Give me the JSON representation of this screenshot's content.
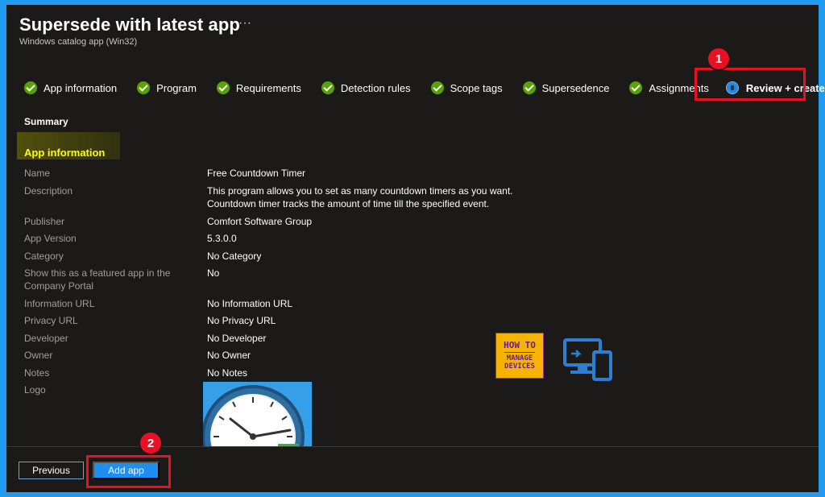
{
  "header": {
    "title": "Supersede with latest app",
    "more_label": "···",
    "subtitle": "Windows catalog app (Win32)"
  },
  "steps": [
    {
      "label": "App information",
      "state": "complete"
    },
    {
      "label": "Program",
      "state": "complete"
    },
    {
      "label": "Requirements",
      "state": "complete"
    },
    {
      "label": "Detection rules",
      "state": "complete"
    },
    {
      "label": "Scope tags",
      "state": "complete"
    },
    {
      "label": "Supersedence",
      "state": "complete"
    },
    {
      "label": "Assignments",
      "state": "complete"
    },
    {
      "label": "Review + create",
      "state": "active"
    }
  ],
  "callouts": {
    "one": "1",
    "two": "2"
  },
  "summary": {
    "heading": "Summary",
    "section_title": "App information",
    "rows": [
      {
        "key": "Name",
        "value": "Free Countdown Timer"
      },
      {
        "key": "Description",
        "value": "This program allows you to set as many countdown timers as you want.",
        "value2": "Countdown timer tracks the amount of time till the specified event."
      },
      {
        "key": "Publisher",
        "value": "Comfort Software Group"
      },
      {
        "key": "App Version",
        "value": "5.3.0.0"
      },
      {
        "key": "Category",
        "value": "No Category"
      },
      {
        "key": "Show this as a featured app in the",
        "key2": "Company Portal",
        "value": "No"
      },
      {
        "key": "Information URL",
        "value": "No Information URL"
      },
      {
        "key": "Privacy URL",
        "value": "No Privacy URL"
      },
      {
        "key": "Developer",
        "value": "No Developer"
      },
      {
        "key": "Owner",
        "value": "No Owner"
      },
      {
        "key": "Notes",
        "value": "No Notes"
      },
      {
        "key": "Logo",
        "value": ""
      }
    ]
  },
  "watermark": {
    "line1": "HOW TO",
    "line2": "MANAGE",
    "line3": "DEVICES"
  },
  "footer": {
    "previous_label": "Previous",
    "add_label": "Add app"
  },
  "colors": {
    "background": "#1b1a19",
    "accent": "#1e8ef0",
    "success": "#57a300",
    "callout": "#e81123",
    "highlight_text": "#ffff00"
  }
}
